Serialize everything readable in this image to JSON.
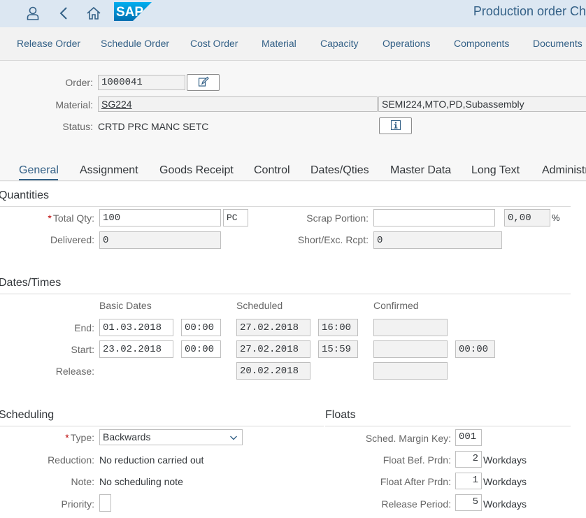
{
  "shell": {
    "title": "Production order Ch",
    "icons": [
      "user-icon",
      "back-icon",
      "home-icon"
    ],
    "logo_text": "SAP"
  },
  "toolbar": {
    "buttons": [
      "Release Order",
      "Schedule Order",
      "Cost Order",
      "Material",
      "Capacity",
      "Operations",
      "Components",
      "Documents"
    ]
  },
  "header": {
    "order_label": "Order:",
    "order_value": "1000041",
    "material_label": "Material:",
    "material_value": "SG224",
    "material_desc": "SEMI224,MTO,PD,Subassembly",
    "status_label": "Status:",
    "status_value": "CRTD PRC  MANC SETC"
  },
  "tabs": [
    "General",
    "Assignment",
    "Goods Receipt",
    "Control",
    "Dates/Qties",
    "Master Data",
    "Long Text",
    "Administr"
  ],
  "quantities": {
    "title": "Quantities",
    "total_qty_label": "Total Qty:",
    "total_qty_value": "100",
    "total_qty_unit": "PC",
    "scrap_label": "Scrap Portion:",
    "scrap_value": "",
    "scrap_pct_value": "0,00",
    "pct_sign": "%",
    "delivered_label": "Delivered:",
    "delivered_value": "0",
    "short_exc_label": "Short/Exc. Rcpt:",
    "short_exc_value": "0"
  },
  "dates": {
    "title": "Dates/Times",
    "col_basic": "Basic Dates",
    "col_scheduled": "Scheduled",
    "col_confirmed": "Confirmed",
    "end_label": "End:",
    "end_basic_date": "01.03.2018",
    "end_basic_time": "00:00",
    "end_sched_date": "27.02.2018",
    "end_sched_time": "16:00",
    "end_confirmed": "",
    "start_label": "Start:",
    "start_basic_date": "23.02.2018",
    "start_basic_time": "00:00",
    "start_sched_date": "27.02.2018",
    "start_sched_time": "15:59",
    "start_confirmed": "",
    "start_confirmed_time": "00:00",
    "release_label": "Release:",
    "release_sched_date": "20.02.2018",
    "release_confirmed": ""
  },
  "scheduling": {
    "title": "Scheduling",
    "type_label": "Type:",
    "type_value": "Backwards",
    "reduction_label": "Reduction:",
    "reduction_value": "No reduction carried out",
    "note_label": "Note:",
    "note_value": "No scheduling note",
    "priority_label": "Priority:",
    "priority_value": ""
  },
  "floats": {
    "title": "Floats",
    "margin_key_label": "Sched. Margin Key:",
    "margin_key_value": "001",
    "float_bef_label": "Float Bef. Prdn:",
    "float_bef_value": "2",
    "float_after_label": "Float After Prdn:",
    "float_after_value": "1",
    "release_period_label": "Release Period:",
    "release_period_value": "5",
    "workdays": "Workdays"
  }
}
